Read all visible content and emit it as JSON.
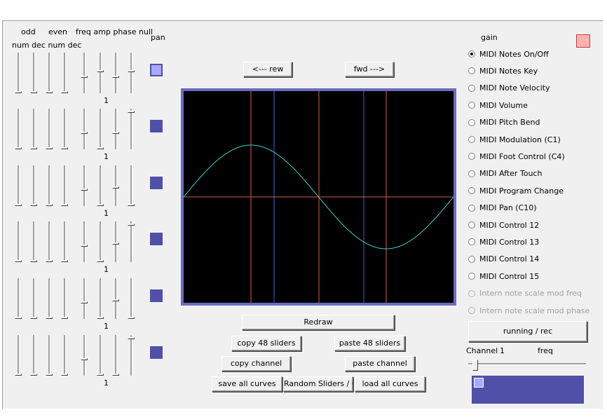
{
  "header": {
    "odd": "odd",
    "even": "even",
    "freq_amp_phase_null": "freq amp phase null",
    "num_dec": "num dec num dec",
    "pan": "pan",
    "gain": "gain"
  },
  "slider_rows": [
    {
      "value": "1"
    },
    {
      "value": "1"
    },
    {
      "value": "1"
    },
    {
      "value": "1"
    },
    {
      "value": "1"
    },
    {
      "value": "1"
    }
  ],
  "nav": {
    "rew": "<--- rew",
    "fwd": "fwd --->"
  },
  "buttons": {
    "redraw": "Redraw",
    "copy48": "copy 48 sliders",
    "paste48": "paste 48 sliders",
    "copy_channel": "copy channel",
    "paste_channel": "paste channel",
    "save_all": "save all curves",
    "random": "Random Sliders / Q",
    "load_all": "load all curves",
    "running": "running / rec"
  },
  "radio_options": [
    {
      "label": "MIDI Notes On/Off",
      "checked": true,
      "disabled": false
    },
    {
      "label": "MIDI Notes Key",
      "checked": false,
      "disabled": false
    },
    {
      "label": "MIDI Note Velocity",
      "checked": false,
      "disabled": false
    },
    {
      "label": "MIDI Volume",
      "checked": false,
      "disabled": false
    },
    {
      "label": "MIDI Pitch Bend",
      "checked": false,
      "disabled": false
    },
    {
      "label": "MIDI Modulation (C1)",
      "checked": false,
      "disabled": false
    },
    {
      "label": "MIDI Foot Control (C4)",
      "checked": false,
      "disabled": false
    },
    {
      "label": "MIDI After Touch",
      "checked": false,
      "disabled": false
    },
    {
      "label": "MIDI Program Change",
      "checked": false,
      "disabled": false
    },
    {
      "label": "MIDI Pan (C10)",
      "checked": false,
      "disabled": false
    },
    {
      "label": "MIDI Control 12",
      "checked": false,
      "disabled": false
    },
    {
      "label": "MIDI Control 13",
      "checked": false,
      "disabled": false
    },
    {
      "label": "MIDI Control 14",
      "checked": false,
      "disabled": false
    },
    {
      "label": "MIDI Control 15",
      "checked": false,
      "disabled": false
    },
    {
      "label": "Intern note scale mod freq",
      "checked": false,
      "disabled": true
    },
    {
      "label": "Intern note scale mod phase",
      "checked": false,
      "disabled": true
    }
  ],
  "channel": {
    "label": "Channel",
    "value": "1",
    "freq_label": "freq"
  },
  "colors": {
    "scope_bg": "#000000",
    "scope_border": "#6a6ac4",
    "wave": "#40d0d0",
    "marker_red": "#d06050",
    "marker_blue": "#4060e0",
    "pan_dark": "#5050a8",
    "pan_light": "#a8a8ff",
    "gain": "#ffb0b0"
  }
}
